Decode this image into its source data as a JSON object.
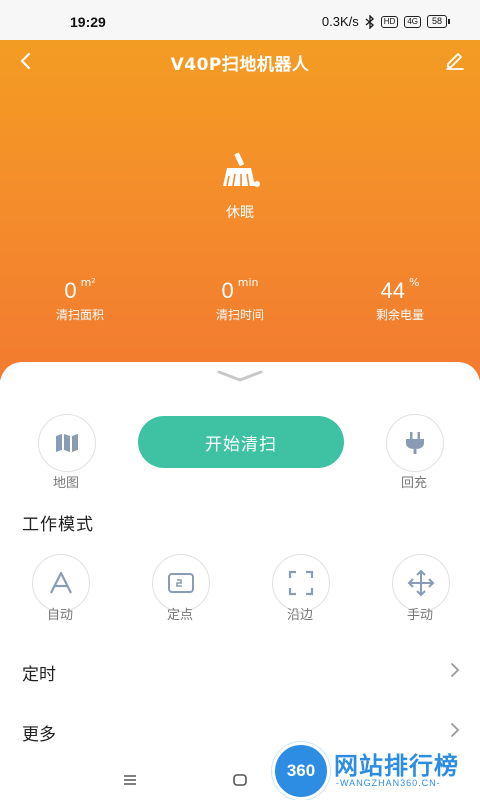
{
  "status_bar": {
    "time": "19:29",
    "net_speed": "0.3K/s",
    "hd_badge": "HD",
    "signal": "4G",
    "battery": "58"
  },
  "header": {
    "title": "V40P扫地机器人"
  },
  "device": {
    "state": "休眠"
  },
  "stats": [
    {
      "value": "0",
      "unit": "m²",
      "label": "清扫面积"
    },
    {
      "value": "0",
      "unit": "min",
      "label": "清扫时间"
    },
    {
      "value": "44",
      "unit": "%",
      "label": "剩余电量"
    }
  ],
  "controls": {
    "map_label": "地图",
    "start_label": "开始清扫",
    "recharge_label": "回充"
  },
  "work_mode": {
    "title": "工作模式",
    "modes": [
      {
        "label": "自动",
        "icon": "auto-icon"
      },
      {
        "label": "定点",
        "icon": "spot-icon"
      },
      {
        "label": "沿边",
        "icon": "edge-icon"
      },
      {
        "label": "手动",
        "icon": "manual-icon"
      }
    ]
  },
  "menu": {
    "timer_label": "定时",
    "more_label": "更多"
  },
  "watermark": {
    "logo_text": "360",
    "name": "网站排行榜",
    "domain": "-WANGZHAN360.CN-"
  },
  "colors": {
    "accent": "#3fc2a4",
    "hero_top": "#f3a021",
    "hero_bottom": "#f27a30"
  }
}
